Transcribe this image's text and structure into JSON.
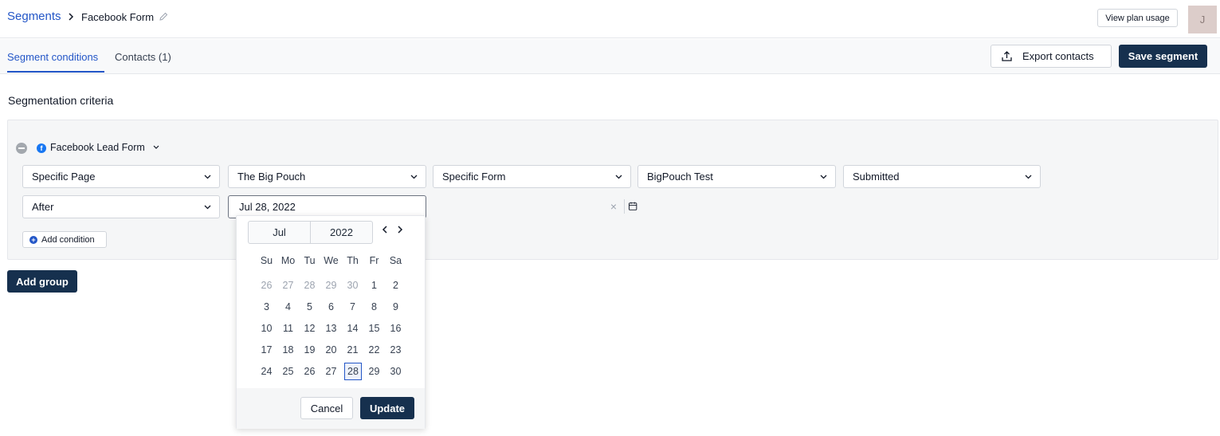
{
  "breadcrumb": {
    "parent": "Segments",
    "current": "Facebook Form"
  },
  "header": {
    "plan_usage_label": "View plan usage",
    "avatar_initial": "J"
  },
  "tabs": [
    {
      "label": "Segment conditions",
      "active": true
    },
    {
      "label": "Contacts (1)",
      "active": false
    }
  ],
  "actions": {
    "export_label": "Export contacts",
    "save_label": "Save segment"
  },
  "section_title": "Segmentation criteria",
  "group": {
    "source_label": "Facebook Lead Form",
    "row1": [
      "Specific Page",
      "The Big Pouch",
      "Specific Form",
      "BigPouch Test",
      "Submitted"
    ],
    "row2_operator": "After",
    "date_value": "Jul 28, 2022",
    "add_condition_label": "Add condition"
  },
  "add_group_label": "Add group",
  "datepicker": {
    "month": "Jul",
    "year": "2022",
    "weekdays": [
      "Su",
      "Mo",
      "Tu",
      "We",
      "Th",
      "Fr",
      "Sa"
    ],
    "weeks": [
      [
        "26",
        "27",
        "28",
        "29",
        "30",
        "1",
        "2"
      ],
      [
        "3",
        "4",
        "5",
        "6",
        "7",
        "8",
        "9"
      ],
      [
        "10",
        "11",
        "12",
        "13",
        "14",
        "15",
        "16"
      ],
      [
        "17",
        "18",
        "19",
        "20",
        "21",
        "22",
        "23"
      ],
      [
        "24",
        "25",
        "26",
        "27",
        "28",
        "29",
        "30"
      ]
    ],
    "muted_days_first_week": [
      "26",
      "27",
      "28",
      "29",
      "30"
    ],
    "selected_day": "28",
    "cancel_label": "Cancel",
    "update_label": "Update"
  },
  "colors": {
    "link_blue": "#2356c7",
    "primary_dark": "#16304e",
    "facebook_blue": "#1877f2"
  }
}
